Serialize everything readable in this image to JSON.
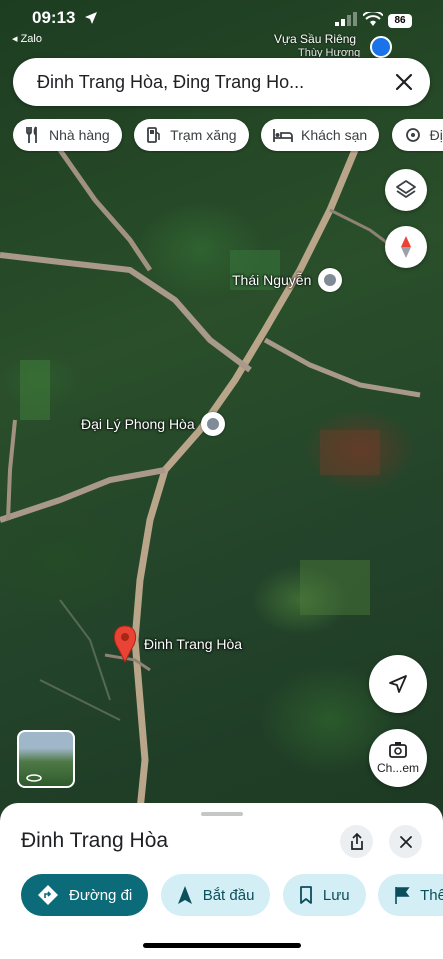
{
  "status_bar": {
    "time": "09:13",
    "back_app": "◂ Zalo",
    "battery": "86",
    "poi_name": "Vựa Sầu Riêng",
    "poi_sub": "Thùy Hương"
  },
  "search": {
    "value": "Đinh Trang Hòa, Đing Trang Ho..."
  },
  "chips": [
    {
      "label": "Nhà hàng",
      "icon": "restaurant-icon"
    },
    {
      "label": "Trạm xăng",
      "icon": "gas-station-icon"
    },
    {
      "label": "Khách sạn",
      "icon": "hotel-icon"
    },
    {
      "label": "Địa",
      "icon": "attraction-icon"
    }
  ],
  "map": {
    "labels": {
      "thai_nguyen": "Thái Nguyễn",
      "dai_ly": "Đại Lý Phong Hòa",
      "pin": "Đinh Trang Hòa"
    },
    "street_view_button": "Ch...em"
  },
  "sheet": {
    "title": "Đinh Trang Hòa",
    "actions": [
      {
        "label": "Đường đi",
        "icon": "directions-icon"
      },
      {
        "label": "Bắt đầu",
        "icon": "navigation-icon"
      },
      {
        "label": "Lưu",
        "icon": "bookmark-icon"
      },
      {
        "label": "Thê",
        "icon": "flag-icon"
      }
    ]
  },
  "colors": {
    "primary_action": "#0b6b78",
    "secondary_action": "#d3eef4",
    "pin_red": "#ea4335"
  }
}
